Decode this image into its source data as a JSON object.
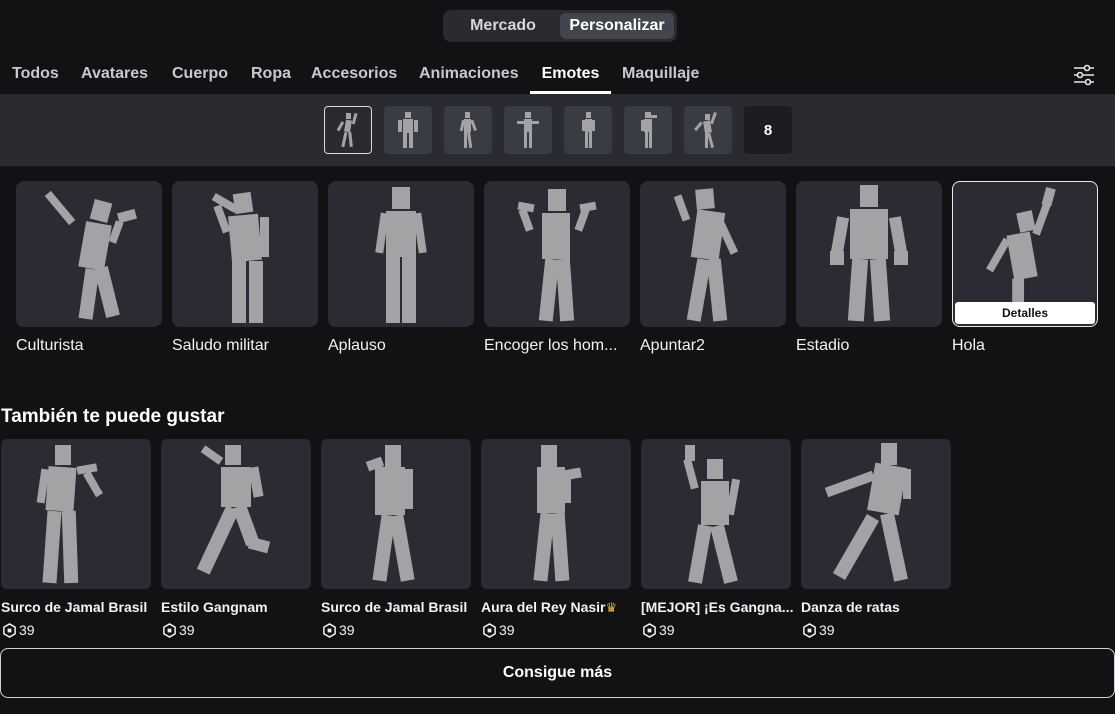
{
  "top_tabs": [
    "Mercado",
    "Personalizar"
  ],
  "categories": [
    "Todos",
    "Avatares",
    "Cuerpo",
    "Ropa",
    "Accesorios",
    "Animaciones",
    "Emotes",
    "Maquillaje"
  ],
  "active_category": "Emotes",
  "filter_icon": "sliders-icon",
  "slots": {
    "count_label": "8"
  },
  "emotes": [
    {
      "name": "Culturista"
    },
    {
      "name": "Saludo militar"
    },
    {
      "name": "Aplauso"
    },
    {
      "name": "Encoger los hom..."
    },
    {
      "name": "Apuntar2"
    },
    {
      "name": "Estadio"
    },
    {
      "name": "Hola"
    }
  ],
  "details_label": "Detalles",
  "recommend": {
    "title": "También te puede gustar",
    "items": [
      {
        "name": "Surco de Jamal Brasil",
        "price": "39"
      },
      {
        "name": "Estilo Gangnam",
        "price": "39"
      },
      {
        "name": "Surco de Jamal Brasil",
        "price": "39"
      },
      {
        "name": "Aura del Rey Nasir",
        "price": "39"
      },
      {
        "name": "[MEJOR] ¡Es Gangna...",
        "price": "39"
      },
      {
        "name": "Danza de ratas",
        "price": "39"
      }
    ]
  },
  "get_more": "Consigue más",
  "colors": {
    "background": "#121215",
    "card": "#2b2c33",
    "figure": "#a3a3a5",
    "crown": "#e8b33c"
  }
}
